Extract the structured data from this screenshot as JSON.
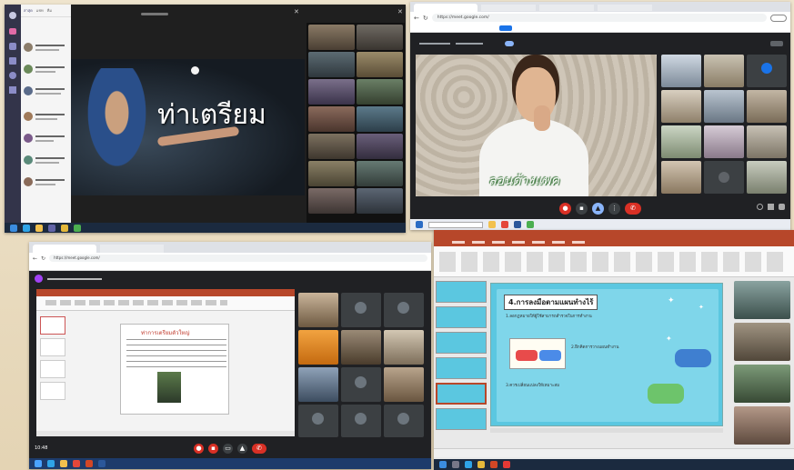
{
  "panel1": {
    "sidebar_tabs": [
      "ล่าสุด",
      "แชท",
      "ทีม"
    ],
    "slide_heading": "ท่าเตรียม"
  },
  "panel2": {
    "address": "https://meet.google.com/",
    "video_caption": "ลอนด้างแพค"
  },
  "panel3": {
    "address": "https://meet.google.com/",
    "slide_heading": "ท่าการเตรียมตัวใหญ่",
    "time_label": "10:48"
  },
  "panel4": {
    "slide_heading": "4.การลงมือตามแผนทำงไร้",
    "slide_items": [
      "1.ลอกฏหมายให้ผู้ใช้สามารถสำรวจในการทำงาน",
      "2.ฝึกคิดการวางแผนทำงาน",
      "3.ควรเปลี่ยนแปลงให้เหมาะสม"
    ]
  },
  "colors": {
    "teams_purple": "#464775",
    "meet_dark": "#202124",
    "end_call_red": "#d93025",
    "slide_teal": "#5bc7e0",
    "ppt_red": "#b7472a"
  }
}
